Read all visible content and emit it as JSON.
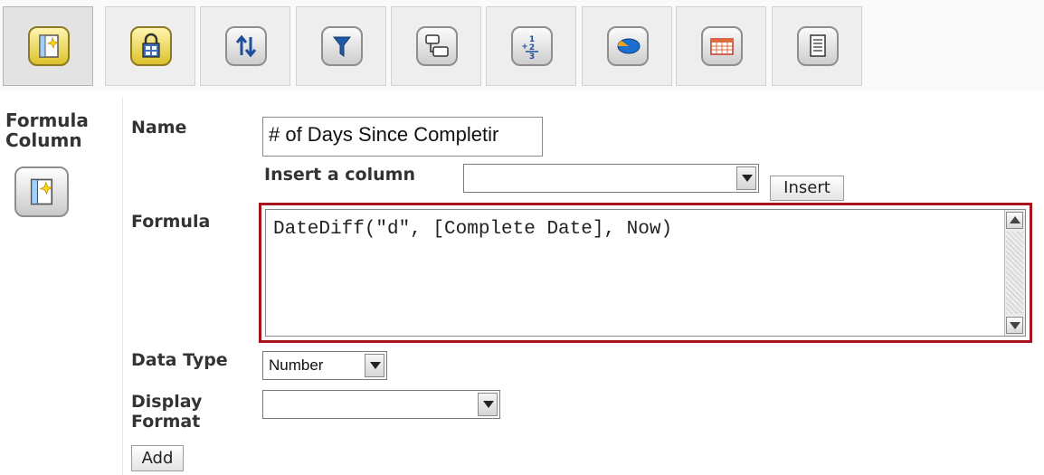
{
  "toolbar": {
    "buttons": [
      {
        "name": "formula-column",
        "icon": "formula-column-icon",
        "active": true
      },
      {
        "name": "lock-columns",
        "icon": "lock-columns-icon"
      },
      {
        "name": "sort",
        "icon": "sort-icon"
      },
      {
        "name": "filter",
        "icon": "filter-icon"
      },
      {
        "name": "group",
        "icon": "group-icon"
      },
      {
        "name": "summary",
        "icon": "summary-icon"
      },
      {
        "name": "chart",
        "icon": "chart-icon"
      },
      {
        "name": "table",
        "icon": "table-icon"
      },
      {
        "name": "page",
        "icon": "page-icon"
      }
    ]
  },
  "sidebar": {
    "title_line1": "Formula",
    "title_line2": "Column",
    "icon": "formula-column-icon"
  },
  "form": {
    "name_label": "Name",
    "name_value": "# of Days Since Completir",
    "insert_column_label": "Insert a column",
    "insert_column_value": "",
    "insert_button": "Insert",
    "formula_label": "Formula",
    "formula_value": "DateDiff(\"d\", [Complete Date], Now)",
    "data_type_label": "Data Type",
    "data_type_value": "Number",
    "display_format_label_line1": "Display",
    "display_format_label_line2": "Format",
    "display_format_value": "",
    "add_button": "Add"
  },
  "colors": {
    "highlight_border": "#a5141c",
    "active_icon": "#dcc12a"
  }
}
